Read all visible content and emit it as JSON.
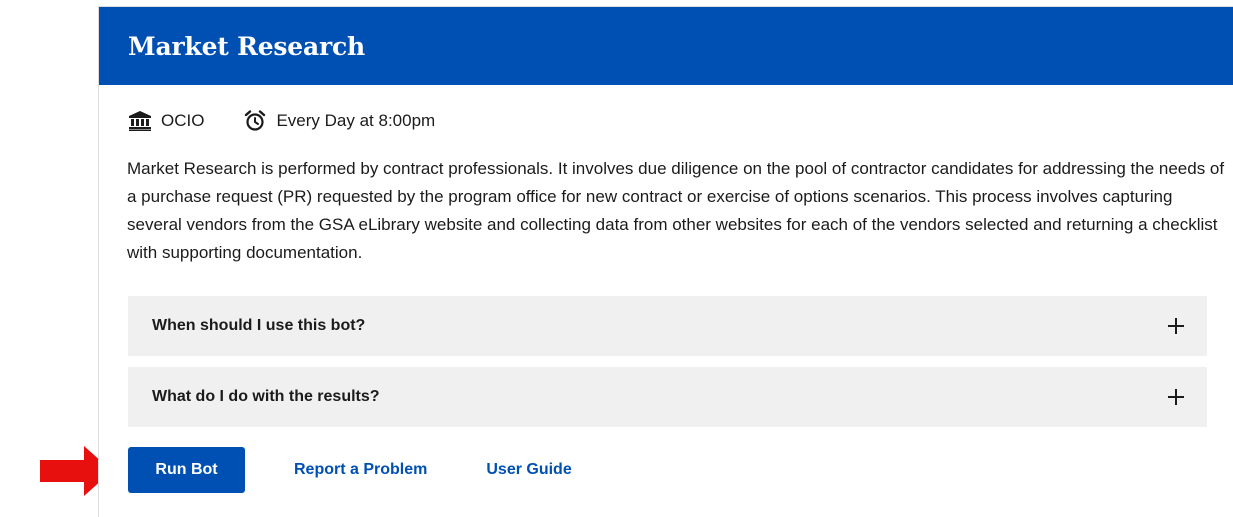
{
  "card": {
    "title": "Market Research",
    "meta": {
      "office_icon": "building-columns-icon",
      "office": "OCIO",
      "schedule_icon": "alarm-clock-icon",
      "schedule": "Every Day at 8:00pm"
    },
    "description": "Market Research is performed by contract professionals. It involves due diligence on the pool of contractor candidates for addressing the needs of a purchase request (PR) requested by the program office for new contract or exercise of options scenarios. This process involves capturing several vendors from the GSA eLibrary website and collecting data from other websites for each of the vendors selected and returning a checklist with supporting documentation.",
    "accordions": [
      {
        "label": "When should I use this bot?",
        "icon": "plus-icon"
      },
      {
        "label": "What do I do with the results?",
        "icon": "plus-icon"
      }
    ],
    "actions": {
      "run_bot": "Run Bot",
      "report_problem": "Report a Problem",
      "user_guide": "User Guide"
    }
  },
  "annotation": {
    "arrow_icon": "red-arrow-icon",
    "arrow_color": "#e8100f"
  },
  "colors": {
    "brand_blue": "#0050b3",
    "accordion_bg": "#f0f0f0",
    "text": "#1b1b1b"
  }
}
